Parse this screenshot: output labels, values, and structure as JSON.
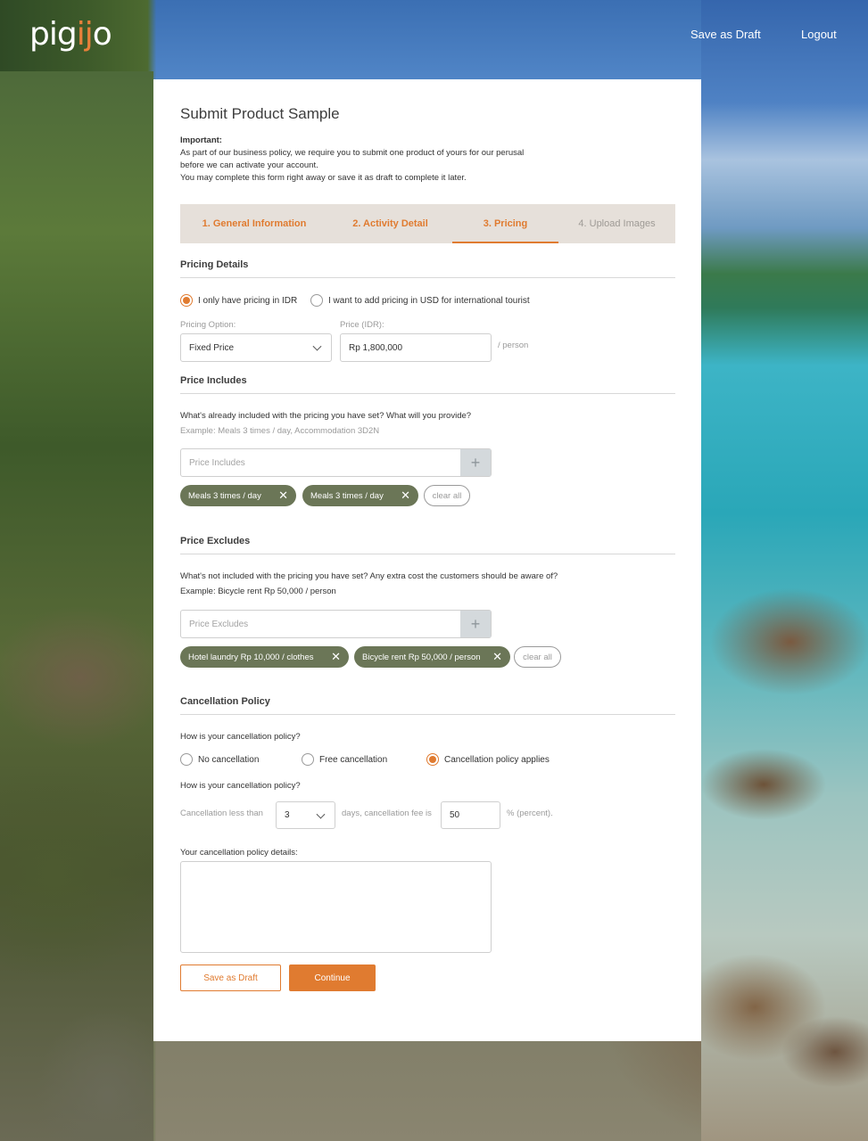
{
  "header": {
    "logo_pre": "pig",
    "logo_accent": "ij",
    "logo_post": "o",
    "save_draft": "Save as Draft",
    "logout": "Logout"
  },
  "form": {
    "title": "Submit Product Sample",
    "notice_heading": "Important:",
    "notice_lines": [
      "As part of our business policy, we require you to submit one product of yours for our perusal",
      "before we can activate your account.",
      "You may complete this form right away or save it as draft to complete it later."
    ],
    "tabs": [
      {
        "label": "1. General Information",
        "state": "done"
      },
      {
        "label": "2. Activity Detail",
        "state": "done"
      },
      {
        "label": "3. Pricing",
        "state": "active"
      },
      {
        "label": "4. Upload Images",
        "state": "upcoming"
      }
    ],
    "pricing": {
      "heading": "Pricing Details",
      "radio_idr": "I only have pricing in IDR",
      "radio_usd": "I want to add pricing in USD for international tourist",
      "selected": "idr",
      "option_label": "Pricing Option:",
      "option_value": "Fixed Price",
      "price_label": "Price (IDR):",
      "price_value": "Rp 1,800,000",
      "per": "/ person"
    },
    "includes": {
      "heading": "Price Includes",
      "question": "What's already included with the pricing you have set? What will you provide?",
      "example": "Example: Meals 3 times / day, Accommodation 3D2N",
      "placeholder": "Price Includes",
      "add": "+",
      "chips": [
        "Meals 3 times / day",
        "Meals 3 times / day"
      ],
      "clear": "clear all"
    },
    "excludes": {
      "heading": "Price Excludes",
      "question": "What's not included with the pricing you have set? Any extra cost the customers should be aware of?",
      "example": "Example: Bicycle rent Rp 50,000 / person",
      "placeholder": "Price Excludes",
      "add": "+",
      "chips": [
        "Hotel laundry Rp 10,000 / clothes",
        "Bicycle rent Rp 50,000 / person"
      ],
      "clear": "clear all"
    },
    "cancellation": {
      "heading": "Cancellation Policy",
      "question1": "How is your cancellation policy?",
      "options": [
        "No cancellation",
        "Free cancellation",
        "Cancellation policy applies"
      ],
      "selected_index": 2,
      "question2": "How is your cancellation policy?",
      "less_than": "Cancellation less than",
      "days_value": "3",
      "days_fee": "days, cancellation fee is",
      "fee_value": "50",
      "percent": "% (percent).",
      "details_label": "Your cancellation policy details:",
      "details_value": ""
    },
    "buttons": {
      "save_draft": "Save as Draft",
      "continue": "Continue"
    }
  },
  "colors": {
    "accent": "#e07b30",
    "chip": "#6b7657",
    "tab_bar": "#e6e0da"
  }
}
